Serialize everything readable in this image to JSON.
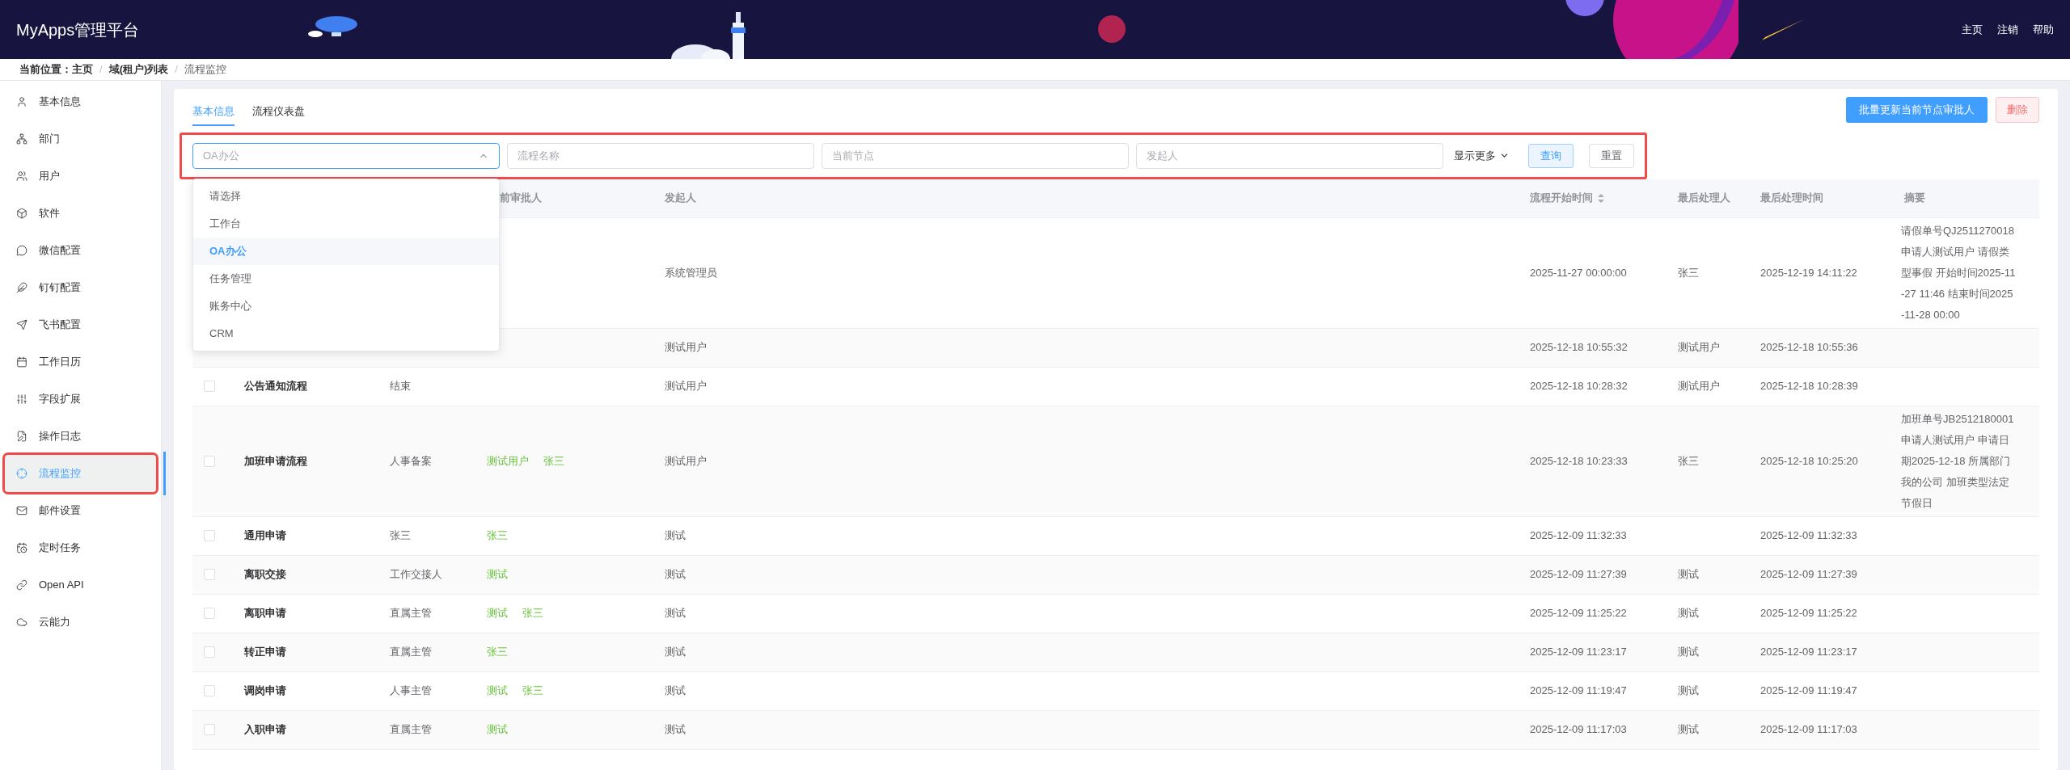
{
  "header": {
    "title": "MyApps管理平台",
    "links": [
      "主页",
      "注销",
      "帮助"
    ]
  },
  "breadcrumb": {
    "label": "当前位置：",
    "separator": "/",
    "items": [
      {
        "text": "主页",
        "current": false
      },
      {
        "text": "域(租户)列表",
        "current": false
      },
      {
        "text": "流程监控",
        "current": true
      }
    ]
  },
  "sidebar": {
    "items": [
      {
        "label": "基本信息",
        "selected": false,
        "highlighted": false
      },
      {
        "label": "部门",
        "selected": false,
        "highlighted": false
      },
      {
        "label": "用户",
        "selected": false,
        "highlighted": false
      },
      {
        "label": "软件",
        "selected": false,
        "highlighted": false
      },
      {
        "label": "微信配置",
        "selected": false,
        "highlighted": false
      },
      {
        "label": "钉钉配置",
        "selected": false,
        "highlighted": false
      },
      {
        "label": "飞书配置",
        "selected": false,
        "highlighted": false
      },
      {
        "label": "工作日历",
        "selected": false,
        "highlighted": false
      },
      {
        "label": "字段扩展",
        "selected": false,
        "highlighted": false
      },
      {
        "label": "操作日志",
        "selected": false,
        "highlighted": false
      },
      {
        "label": "流程监控",
        "selected": true,
        "highlighted": true
      },
      {
        "label": "邮件设置",
        "selected": false,
        "highlighted": false
      },
      {
        "label": "定时任务",
        "selected": false,
        "highlighted": false
      },
      {
        "label": "Open API",
        "selected": false,
        "highlighted": false
      },
      {
        "label": "云能力",
        "selected": false,
        "highlighted": false
      }
    ]
  },
  "tabs": [
    {
      "label": "基本信息",
      "selected": true
    },
    {
      "label": "流程仪表盘",
      "selected": false
    }
  ],
  "actions": {
    "primary": "批量更新当前节点审批人",
    "danger": "删除"
  },
  "filter": {
    "highlighted": true,
    "select": {
      "value": "OA办公",
      "expanded": true,
      "options": [
        {
          "label": "请选择",
          "selected": false
        },
        {
          "label": "工作台",
          "selected": false
        },
        {
          "label": "OA办公",
          "selected": true
        },
        {
          "label": "任务管理",
          "selected": false
        },
        {
          "label": "账务中心",
          "selected": false
        },
        {
          "label": "CRM",
          "selected": false
        }
      ]
    },
    "inputs": [
      {
        "placeholder": "流程名称"
      },
      {
        "placeholder": "当前节点"
      },
      {
        "placeholder": "发起人"
      }
    ],
    "more": "显示更多",
    "search": "查询",
    "reset": "重置"
  },
  "table": {
    "columns": [
      {
        "label": "前审批人"
      },
      {
        "label": "发起人"
      },
      {
        "label": "流程开始时间",
        "sortable": true
      },
      {
        "label": "最后处理人"
      },
      {
        "label": "最后处理时间"
      },
      {
        "label": "摘要"
      }
    ],
    "rows": [
      {
        "initiator": "系统管理员",
        "start_time": "2025-11-27 00:00:00",
        "last_handler": "张三",
        "last_time": "2025-12-19 14:11:22",
        "summary": "请假单号QJ2511270018 申请人测试用户 请假类型事假 开始时间2025-11-27 11:46 结束时间2025-11-28 00:00"
      },
      {
        "initiator": "测试用户",
        "start_time": "2025-12-18 10:55:32",
        "last_handler": "测试用户",
        "last_time": "2025-12-18 10:55:36"
      },
      {
        "checked": false,
        "name": "公告通知流程",
        "node": "结束",
        "approvers": [],
        "initiator": "测试用户",
        "start_time": "2025-12-18 10:28:32",
        "last_handler": "测试用户",
        "last_time": "2025-12-18 10:28:39"
      },
      {
        "checked": false,
        "name": "加班申请流程",
        "node": "人事备案",
        "approvers": [
          "测试用户",
          "张三"
        ],
        "initiator": "测试用户",
        "start_time": "2025-12-18 10:23:33",
        "last_handler": "张三",
        "last_time": "2025-12-18 10:25:20",
        "summary": "加班单号JB2512180001 申请人测试用户 申请日期2025-12-18 所属部门我的公司 加班类型法定节假日"
      },
      {
        "checked": false,
        "name": "通用申请",
        "node": "张三",
        "approvers": [
          "张三"
        ],
        "initiator": "测试",
        "start_time": "2025-12-09 11:32:33",
        "last_time": "2025-12-09 11:32:33"
      },
      {
        "checked": false,
        "name": "离职交接",
        "node": "工作交接人",
        "approvers": [
          "测试"
        ],
        "initiator": "测试",
        "start_time": "2025-12-09 11:27:39",
        "last_handler": "测试",
        "last_time": "2025-12-09 11:27:39"
      },
      {
        "checked": false,
        "name": "离职申请",
        "node": "直属主管",
        "approvers": [
          "测试",
          "张三"
        ],
        "initiator": "测试",
        "start_time": "2025-12-09 11:25:22",
        "last_handler": "测试",
        "last_time": "2025-12-09 11:25:22"
      },
      {
        "checked": false,
        "name": "转正申请",
        "node": "直属主管",
        "approvers": [
          "张三"
        ],
        "initiator": "测试",
        "start_time": "2025-12-09 11:23:17",
        "last_handler": "测试",
        "last_time": "2025-12-09 11:23:17"
      },
      {
        "checked": false,
        "name": "调岗申请",
        "node": "人事主管",
        "approvers": [
          "测试",
          "张三"
        ],
        "initiator": "测试",
        "start_time": "2025-12-09 11:19:47",
        "last_handler": "测试",
        "last_time": "2025-12-09 11:19:47"
      },
      {
        "checked": false,
        "name": "入职申请",
        "node": "直属主管",
        "approvers": [
          "测试"
        ],
        "initiator": "测试",
        "start_time": "2025-12-09 11:17:03",
        "last_handler": "测试",
        "last_time": "2025-12-09 11:17:03"
      }
    ]
  }
}
